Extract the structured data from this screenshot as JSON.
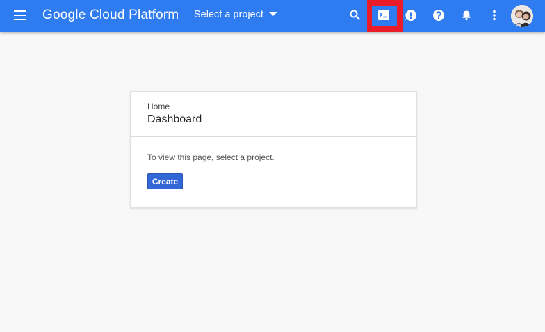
{
  "header": {
    "menu_icon": "hamburger-menu-icon",
    "app_title": "Google Cloud Platform",
    "project_selector": {
      "label": "Select a project",
      "icon": "caret-down-icon"
    },
    "actions": [
      {
        "name": "search",
        "icon": "search-icon"
      },
      {
        "name": "cloud-shell",
        "icon": "terminal-icon",
        "highlighted": true
      },
      {
        "name": "feedback",
        "icon": "feedback-icon"
      },
      {
        "name": "help",
        "icon": "help-icon"
      },
      {
        "name": "notifications",
        "icon": "bell-icon"
      },
      {
        "name": "more",
        "icon": "more-vert-icon"
      },
      {
        "name": "account",
        "icon": "avatar"
      }
    ]
  },
  "card": {
    "breadcrumb": "Home",
    "title": "Dashboard",
    "message": "To view this page, select a project.",
    "create_label": "Create"
  },
  "colors": {
    "topbar": "#2f7cf0",
    "highlight": "#ea1c28",
    "primary_button": "#3367d6",
    "page_background": "#f8f8f8"
  }
}
